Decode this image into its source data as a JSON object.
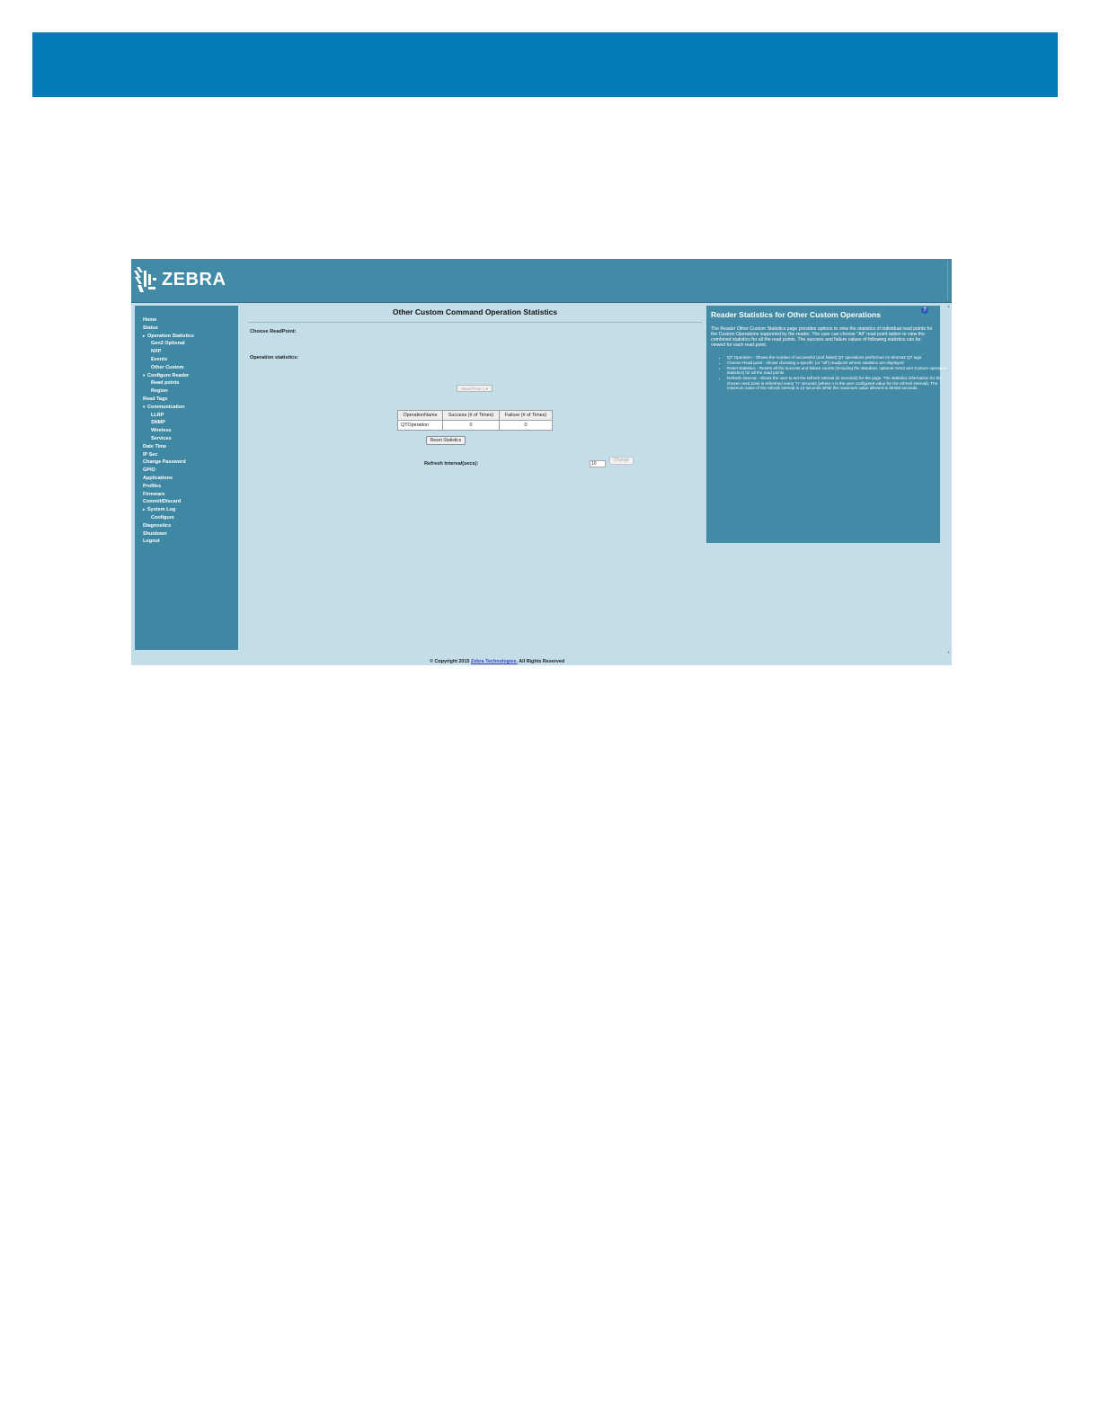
{
  "header": {
    "logo_text": "ZEBRA",
    "colors": {
      "doc_banner": "#027ab5",
      "app_bar": "#428aa5",
      "sidebar": "#3f88a3",
      "background": "#c4dee9"
    }
  },
  "sidebar": {
    "items": [
      {
        "label": "Home",
        "level": 0
      },
      {
        "label": "Status",
        "level": 0
      },
      {
        "label": "Operation Statistics",
        "level": 0,
        "arrow": "▸"
      },
      {
        "label": "Gen2 Optional",
        "level": 1
      },
      {
        "label": "NXP",
        "level": 1
      },
      {
        "label": "Events",
        "level": 1
      },
      {
        "label": "Other Custom",
        "level": 1
      },
      {
        "label": "Configure Reader",
        "level": 0,
        "arrow": "▾"
      },
      {
        "label": "Read points",
        "level": 1
      },
      {
        "label": "Region",
        "level": 1
      },
      {
        "label": "Read Tags",
        "level": 0
      },
      {
        "label": "Communication",
        "level": 0,
        "arrow": "▾"
      },
      {
        "label": "LLRP",
        "level": 1
      },
      {
        "label": "SNMP",
        "level": 1
      },
      {
        "label": "Wireless",
        "level": 1
      },
      {
        "label": "Services",
        "level": 1
      },
      {
        "label": "Date Time",
        "level": 0
      },
      {
        "label": "IP Sec",
        "level": 0
      },
      {
        "label": "Change Password",
        "level": 0
      },
      {
        "label": "GPIO",
        "level": 0
      },
      {
        "label": "Applications",
        "level": 0
      },
      {
        "label": "Profiles",
        "level": 0
      },
      {
        "label": "Firmware",
        "level": 0
      },
      {
        "label": "Commit/Discard",
        "level": 0
      },
      {
        "label": "System Log",
        "level": 0,
        "arrow": "▸"
      },
      {
        "label": "Configure",
        "level": 1
      },
      {
        "label": "Diagnostics",
        "level": 0
      },
      {
        "label": "Shutdown",
        "level": 0
      },
      {
        "label": "Logout",
        "level": 0
      }
    ]
  },
  "main": {
    "title": "Other Custom Command Operation Statistics",
    "choose_readpoint_label": "Choose ReadPoint:",
    "readpoint_select_value": "Read Point 1",
    "operation_statistics_label": "Operation statistics:",
    "table": {
      "headers": [
        "OperationName",
        "Success (# of Times)",
        "Failure (# of Times)"
      ],
      "rows": [
        [
          "QTOperation",
          "0",
          "0"
        ]
      ]
    },
    "reset_button": "Reset Statistics",
    "refresh_label": "Refresh Interval(secs):",
    "refresh_value": "10",
    "change_button": "Change"
  },
  "help": {
    "title": "Reader Statistics for Other Custom Operations",
    "icon": "?",
    "intro": "The Reader Other Custom Statistics page provides options to view the statistics of individual read points for the Custom Operations supported by the reader. The user can choose \"All\" read point option to view the combined statistics for all the read points. The success and failure values of following statistics can be viewed for each read point.",
    "bullets": [
      "QT Operation - Shows the number of successful (and failed) QT operations performed on Monza4 QT tags",
      "Choose Read point - Allows choosing a specific (or \"all\") readpoint whose statistics are displayed",
      "Reset Statistics - Resets all the success and failure counts (including the standard, optional Gen2 and Custom operation statistics) for all the read points",
      "Refresh Interval - Allows the user to set the refresh interval (in seconds) for the page. The statistics information for the chosen read point is refreshed every \"n\" seconds (where n is the user configured value for the refresh interval). The minimum value of the refresh interval is 10 seconds while the maximum value allowed is 86400 seconds."
    ]
  },
  "footer": {
    "prefix": "© Copyright 2015",
    "link": "Zebra Technologies.",
    "suffix": "All Rights Reserved"
  }
}
